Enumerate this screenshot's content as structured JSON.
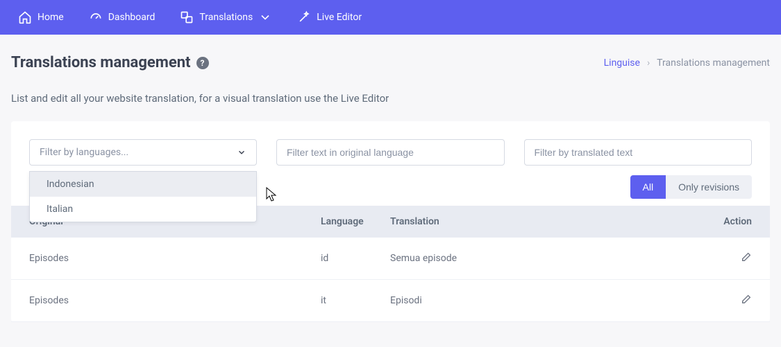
{
  "nav": {
    "home": "Home",
    "dashboard": "Dashboard",
    "translations": "Translations",
    "live_editor": "Live Editor"
  },
  "page": {
    "title": "Translations management",
    "subtitle": "List and edit all your website translation, for a visual translation use the Live Editor"
  },
  "breadcrumb": {
    "root": "Linguise",
    "current": "Translations management"
  },
  "filters": {
    "lang_placeholder": "Filter by languages...",
    "original_placeholder": "Filter text in original language",
    "translated_placeholder": "Filter by translated text",
    "dropdown": {
      "option1": "Indonesian",
      "option2": "Italian"
    }
  },
  "toggle": {
    "all": "All",
    "revisions": "Only revisions"
  },
  "table": {
    "headers": {
      "original": "Original",
      "language": "Language",
      "translation": "Translation",
      "action": "Action"
    },
    "rows": [
      {
        "original": "Episodes",
        "language": "id",
        "translation": "Semua episode"
      },
      {
        "original": "Episodes",
        "language": "it",
        "translation": "Episodi"
      }
    ]
  }
}
